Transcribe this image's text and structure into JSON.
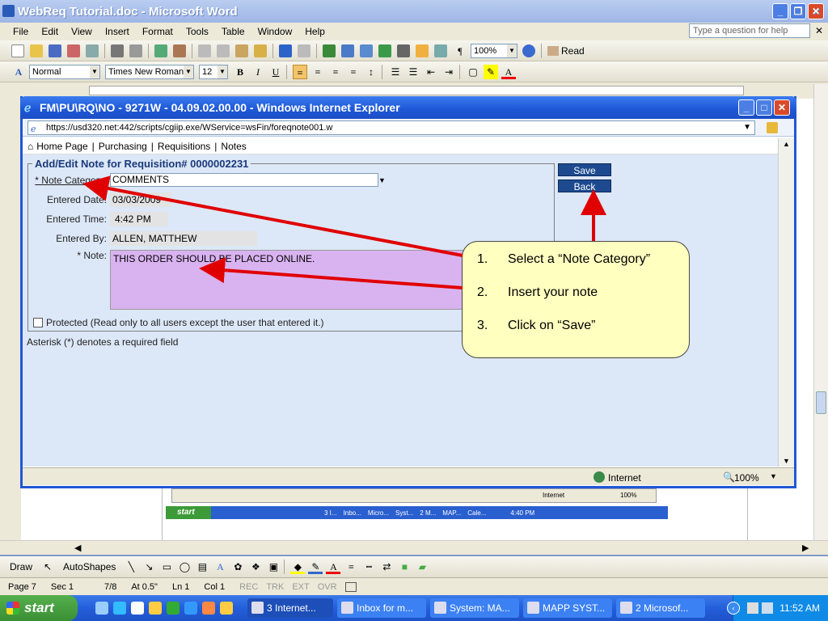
{
  "word": {
    "title": "WebReq Tutorial.doc - Microsoft Word",
    "menus": [
      "File",
      "Edit",
      "View",
      "Insert",
      "Format",
      "Tools",
      "Table",
      "Window",
      "Help"
    ],
    "help_placeholder": "Type a question for help",
    "zoom": "100%",
    "read_label": "Read",
    "style": "Normal",
    "font": "Times New Roman",
    "font_size": "12",
    "draw_label": "Draw",
    "autoshapes_label": "AutoShapes",
    "status": {
      "page": "Page 7",
      "sec": "Sec 1",
      "pages": "7/8",
      "at": "At 0.5\"",
      "ln": "Ln 1",
      "col": "Col 1",
      "rec": "REC",
      "trk": "TRK",
      "ext": "EXT",
      "ovr": "OVR"
    }
  },
  "ie": {
    "title": "FM\\PU\\RQ\\NO - 9271W - 04.09.02.00.00 - Windows Internet Explorer",
    "url": "https://usd320.net:442/scripts/cgiip.exe/WService=wsFin/foreqnote001.w",
    "nav": [
      "Home Page",
      "Purchasing",
      "Requisitions",
      "Notes"
    ],
    "status_zone": "Internet",
    "status_zoom": "100%"
  },
  "form": {
    "legend": "Add/Edit Note for Requisition# 0000002231",
    "note_category_label": "* Note Category:",
    "note_category_value": "COMMENTS",
    "entered_date_label": "Entered Date:",
    "entered_date_value": "03/03/2009",
    "entered_time_label": "Entered Time:",
    "entered_time_value": "4:42 PM",
    "entered_by_label": "Entered By:",
    "entered_by_value": "ALLEN, MATTHEW",
    "note_label": "* Note:",
    "note_value": "THIS ORDER SHOULD BE PLACED ONLINE.",
    "protected_label": "Protected (Read only to all users except the user that entered it.)",
    "save_label": "Save",
    "back_label": "Back",
    "asterisk_note": "Asterisk (*) denotes a required field"
  },
  "callout": {
    "steps": [
      {
        "num": "1.",
        "text": "Select a “Note Category”"
      },
      {
        "num": "2.",
        "text": "Insert your note"
      },
      {
        "num": "3.",
        "text": "Click on “Save”"
      }
    ]
  },
  "inner_taskbar": {
    "start": "start",
    "tasks": [
      "3 I...",
      "Inbo...",
      "Micro...",
      "Syst...",
      "2 M...",
      "MAP...",
      "Cale..."
    ],
    "clock": "4:40 PM",
    "zone": "Internet",
    "zoom": "100%"
  },
  "taskbar": {
    "start": "start",
    "tasks": [
      "3 Internet...",
      "Inbox for m...",
      "System: MA...",
      "MAPP SYST...",
      "2 Microsof..."
    ],
    "clock": "11:52 AM"
  },
  "colors": {
    "ie_title": "#1d56d5",
    "note_bg": "#d9b3f0",
    "callout_bg": "#ffffc0",
    "arrow": "#e00000",
    "button_bg": "#1d4a8f"
  }
}
